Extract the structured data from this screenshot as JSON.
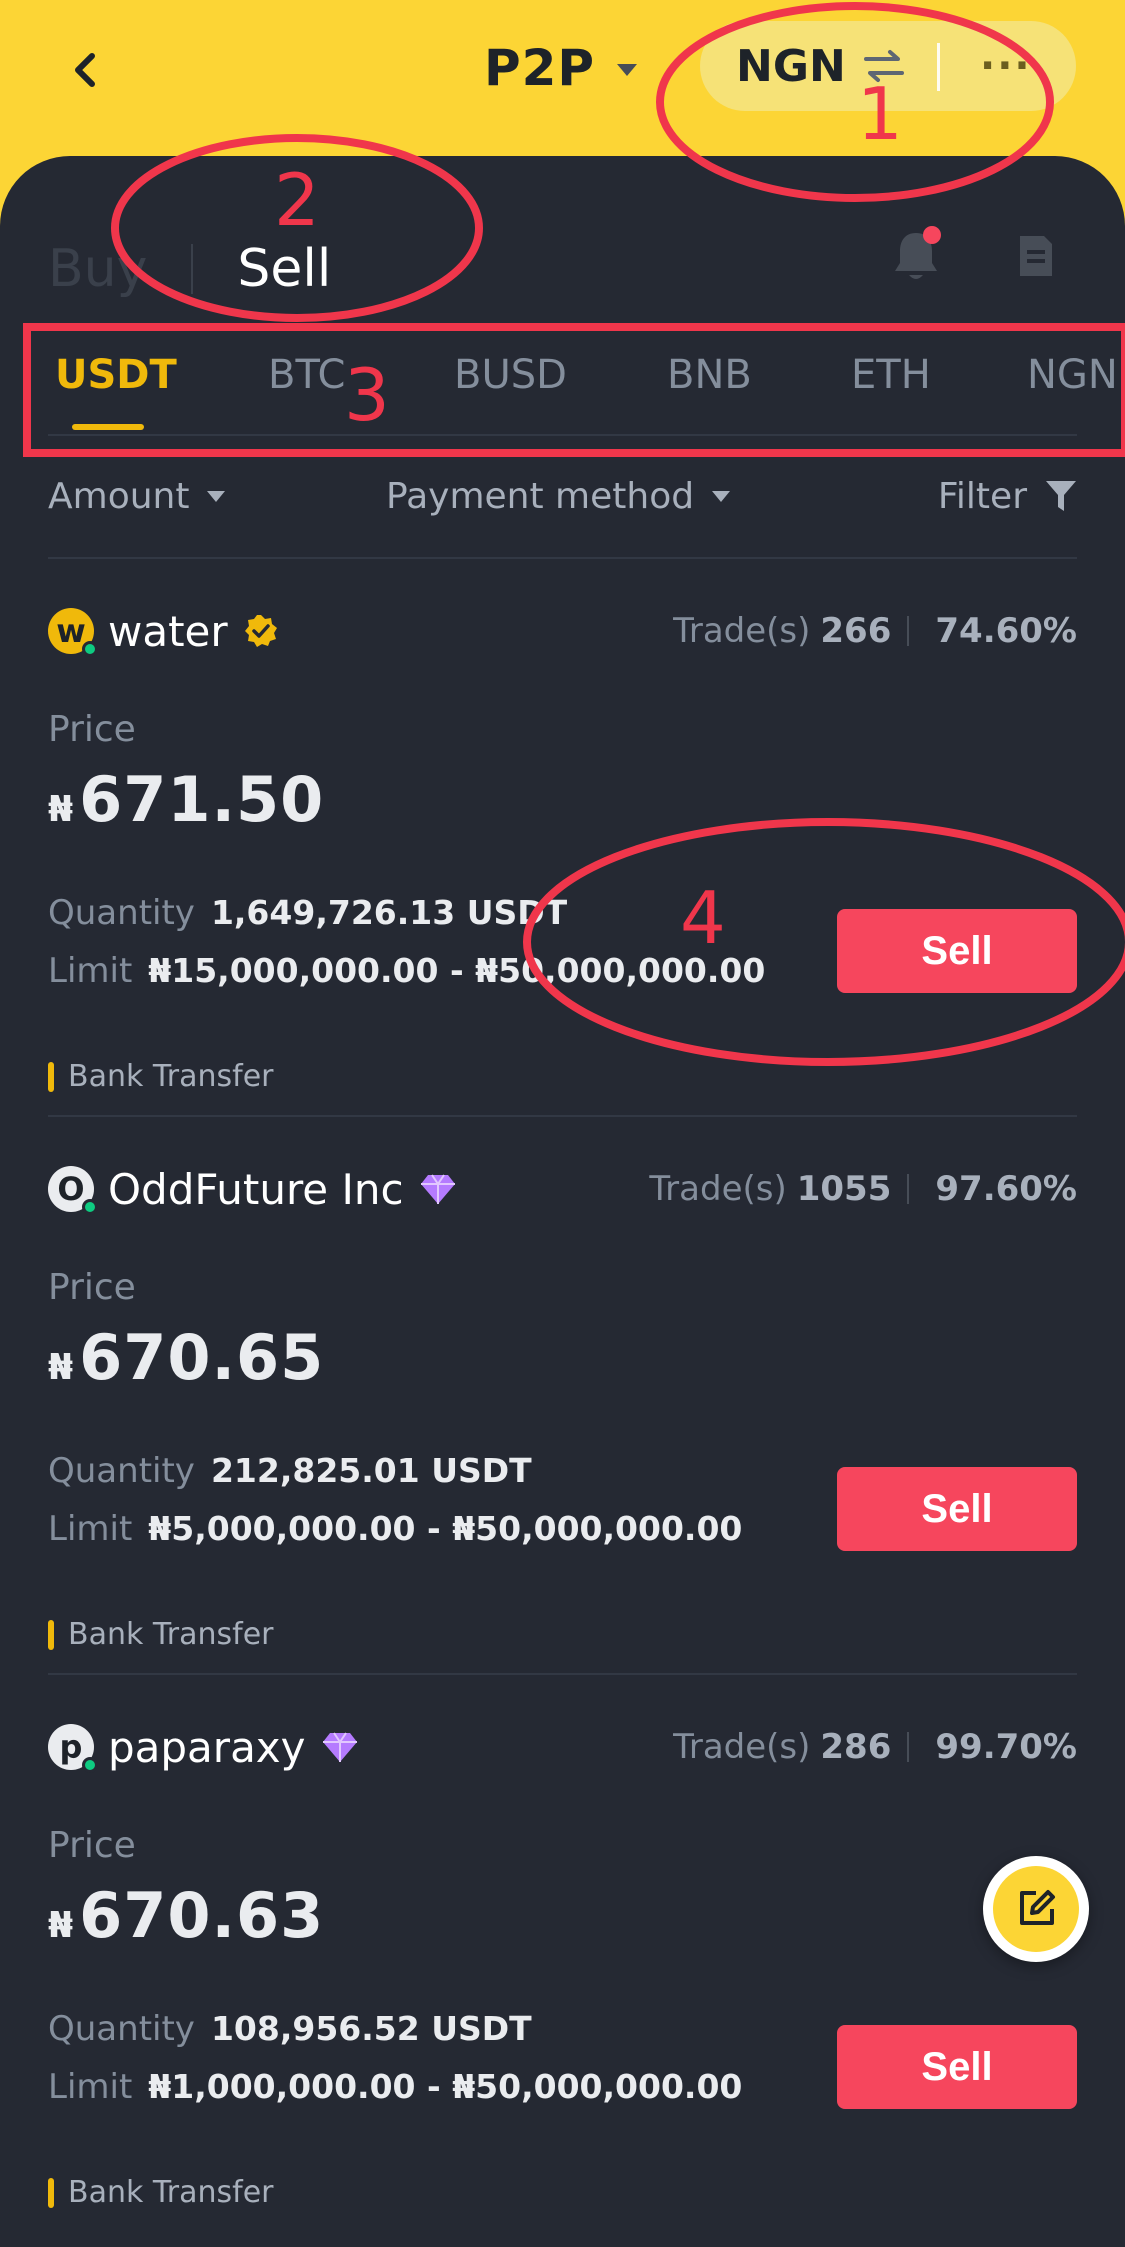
{
  "header": {
    "title": "P2P",
    "currency": "NGN",
    "more": "···"
  },
  "side_tabs": {
    "buy": "Buy",
    "sell": "Sell"
  },
  "coin_tabs": [
    "USDT",
    "BTC",
    "BUSD",
    "BNB",
    "ETH",
    "NGN"
  ],
  "filters": {
    "amount": "Amount",
    "payment": "Payment method",
    "filter": "Filter"
  },
  "labels": {
    "trades": "Trade(s)",
    "price": "Price",
    "quantity": "Quantity",
    "limit": "Limit",
    "sell_button": "Sell"
  },
  "ads": [
    {
      "initial": "w",
      "name": "water",
      "badge": "verified-check",
      "trades": "266",
      "completion": "74.60%",
      "currency_symbol": "₦",
      "price": "671.50",
      "quantity": "1,649,726.13 USDT",
      "limit": "₦15,000,000.00 - ₦50,000,000.00",
      "payment": "Bank Transfer"
    },
    {
      "initial": "O",
      "name": "OddFuture Inc",
      "badge": "diamond",
      "trades": "1055",
      "completion": "97.60%",
      "currency_symbol": "₦",
      "price": "670.65",
      "quantity": "212,825.01 USDT",
      "limit": "₦5,000,000.00 - ₦50,000,000.00",
      "payment": "Bank Transfer"
    },
    {
      "initial": "p",
      "name": "paparaxy",
      "badge": "diamond",
      "trades": "286",
      "completion": "99.70%",
      "currency_symbol": "₦",
      "price": "670.63",
      "quantity": "108,956.52 USDT",
      "limit": "₦1,000,000.00 - ₦50,000,000.00",
      "payment": "Bank Transfer"
    }
  ],
  "annotations": [
    "1",
    "2",
    "3",
    "4"
  ],
  "colors": {
    "brand_yellow": "#FCD535",
    "sheet": "#252933",
    "sell_red": "#F6465D",
    "active_tab": "#F0B90B",
    "annotation_red": "#F0364B"
  }
}
